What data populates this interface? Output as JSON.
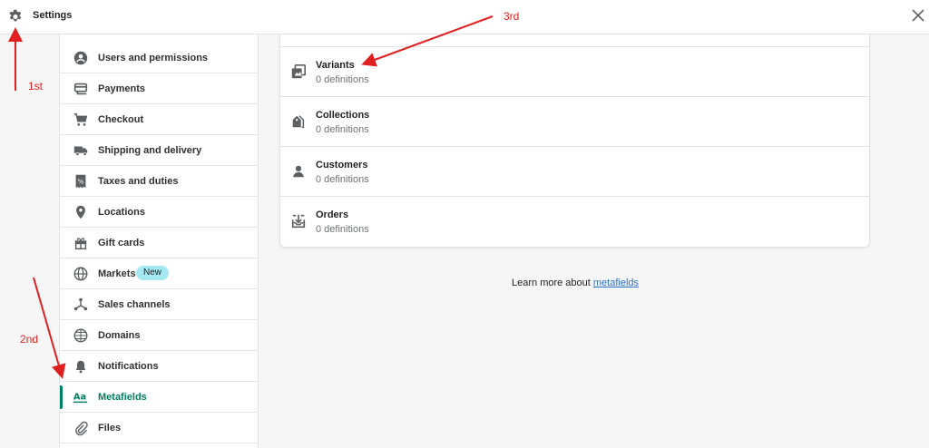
{
  "header": {
    "title": "Settings",
    "settings_icon": "gear-icon",
    "close_icon": "close-icon"
  },
  "sidebar": {
    "items": [
      {
        "label": "Users and permissions",
        "icon": "user-circle-icon"
      },
      {
        "label": "Payments",
        "icon": "payment-card-icon"
      },
      {
        "label": "Checkout",
        "icon": "cart-icon"
      },
      {
        "label": "Shipping and delivery",
        "icon": "truck-icon"
      },
      {
        "label": "Taxes and duties",
        "icon": "tax-receipt-icon"
      },
      {
        "label": "Locations",
        "icon": "location-pin-icon"
      },
      {
        "label": "Gift cards",
        "icon": "gift-icon"
      },
      {
        "label": "Markets",
        "icon": "globe-icon",
        "badge": "New"
      },
      {
        "label": "Sales channels",
        "icon": "channels-icon"
      },
      {
        "label": "Domains",
        "icon": "domain-globe-icon"
      },
      {
        "label": "Notifications",
        "icon": "bell-icon"
      },
      {
        "label": "Metafields",
        "icon": "metafields-icon",
        "active": true
      },
      {
        "label": "Files",
        "icon": "paperclip-icon"
      }
    ]
  },
  "main": {
    "rows": [
      {
        "title": "Variants",
        "subtitle": "0 definitions",
        "icon": "variants-icon"
      },
      {
        "title": "Collections",
        "subtitle": "0 definitions",
        "icon": "collections-icon"
      },
      {
        "title": "Customers",
        "subtitle": "0 definitions",
        "icon": "customer-icon"
      },
      {
        "title": "Orders",
        "subtitle": "0 definitions",
        "icon": "orders-icon"
      }
    ],
    "learn_more": {
      "prefix": "Learn more about ",
      "link": "metafields"
    }
  },
  "annotations": {
    "first": "1st",
    "second": "2nd",
    "third": "3rd",
    "color": "#e02020"
  },
  "colors": {
    "accent": "#008060",
    "badge": "#a4e8f2",
    "link": "#2c6ecb"
  }
}
